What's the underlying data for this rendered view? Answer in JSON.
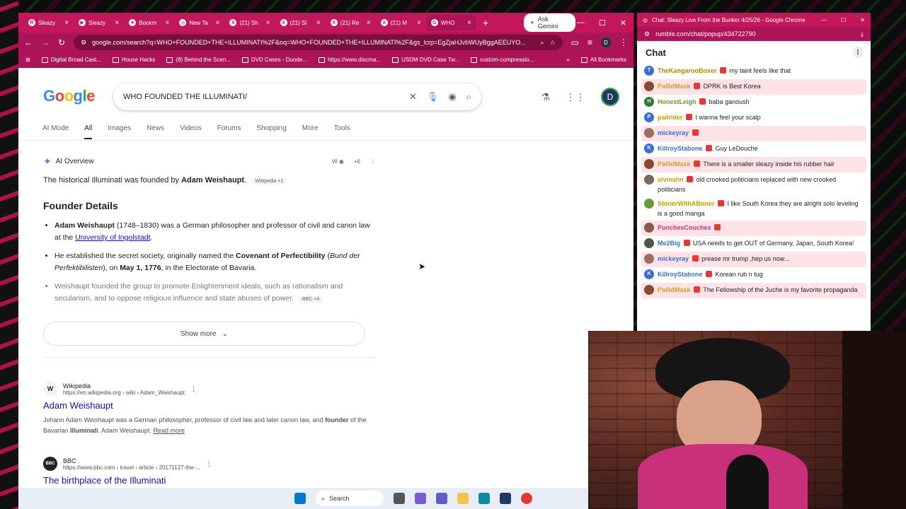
{
  "browser": {
    "tabs": [
      {
        "label": "Sleazy",
        "icon": "R",
        "active": false
      },
      {
        "label": "Sleazy",
        "icon": "▶",
        "active": false
      },
      {
        "label": "Bookm",
        "icon": "★",
        "active": false
      },
      {
        "label": "New Ta",
        "icon": "◎",
        "active": false
      },
      {
        "label": "(21) Sh",
        "icon": "X",
        "active": false
      },
      {
        "label": "(21) Sl",
        "icon": "X",
        "active": false
      },
      {
        "label": "(21) Re",
        "icon": "X",
        "active": false
      },
      {
        "label": "(21) M",
        "icon": "X",
        "active": false
      },
      {
        "label": "WHO",
        "icon": "G",
        "active": true
      }
    ],
    "ask_gemini": "Ask Gemini",
    "url": "google.com/search?q=WHO+FOUNDED+THE+ILLUMINATI%2F&oq=WHO+FOUNDED+THE+ILLUMINATI%2F&gs_lcrp=EgZjaHJvbWUyBggAEEUYO...",
    "profile_initial": "D",
    "bookmarks": [
      "Digital Broad Cast...",
      "House Hacks",
      "(8) Behind the Scen...",
      "DVD Cases - Duode...",
      "https://www.discma...",
      "USDM DVD Case Tw...",
      "custom-compressio..."
    ],
    "all_bookmarks": "All Bookmarks",
    "accent": "#c2185b"
  },
  "google": {
    "logo": "Google",
    "query": "WHO FOUNDED THE ILLUMINATI/",
    "account_initial": "D",
    "nav": [
      "AI Mode",
      "All",
      "Images",
      "News",
      "Videos",
      "Forums",
      "Shopping",
      "More",
      "Tools"
    ],
    "ai_overview": {
      "label": "AI Overview",
      "sources_more": "+6",
      "lead_pre": "The historical Illuminati was founded by ",
      "lead_bold": "Adam Weishaupt",
      "lead_post": ".",
      "lead_chip": "Wikipedia +1",
      "heading": "Founder Details",
      "b1_bold": "Adam Weishaupt",
      "b1_text": " (1748–1830) was a German philosopher and professor of civil and canon law at the ",
      "b1_link": "University of Ingolstadt",
      "b1_end": ".",
      "b2_pre": "He established the secret society, originally named the ",
      "b2_bold": "Covenant of Perfectibility",
      "b2_mid": " (",
      "b2_italic": "Bund der Perfektibilisten",
      "b2_mid2": "), on ",
      "b2_date": "May 1, 1776",
      "b2_end": ", in the Electorate of Bavaria.",
      "b3": "Weishaupt founded the group to promote Enlightenment ideals, such as rationalism and secularism, and to oppose religious influence and state abuses of power.",
      "b3_chip": "BBC +4",
      "show_more": "Show more"
    },
    "results": [
      {
        "site": "Wikipedia",
        "fav": "W",
        "cite": "https://en.wikipedia.org › wiki › Adam_Weishaupt",
        "title": "Adam Weishaupt",
        "snippet_pre": "Johann Adam Weishaupt was a German philosopher, professor of civil law and later canon law, and ",
        "snippet_b1": "founder",
        "snippet_mid": " of the Bavarian ",
        "snippet_b2": "Illuminati",
        "snippet_post": ". Adam Weishaupt.",
        "read_more": "Read more"
      },
      {
        "site": "BBC",
        "fav": "BBC",
        "cite": "https://www.bbc.com › travel › article › 20171127-the-...",
        "title": "The birthplace of the Illuminati"
      }
    ]
  },
  "chat": {
    "window_title": "Chat: Sleazy Live From the Bunker 4/25/26 - Google Chrome",
    "url": "rumble.com/chat/popup/434722790",
    "heading": "Chat",
    "messages": [
      {
        "user": "TheKangarooBoxer",
        "text": "my taint feels like that",
        "color": "#b58900",
        "ava": "#3b6fd4",
        "hl": false,
        "ava_letter": "T"
      },
      {
        "user": "PallidMask",
        "text": "DPRK is Best Korea",
        "color": "#d4a017",
        "ava": "#8a4a30",
        "hl": true,
        "ava_letter": ""
      },
      {
        "user": "HonestLeigh",
        "text": "baba ganoush",
        "color": "#6a9a2a",
        "ava": "#2e7d32",
        "hl": false,
        "ava_letter": "H"
      },
      {
        "user": "pailrider",
        "text": "I wanna feel your scalp",
        "color": "#c2a000",
        "ava": "#3b6fd4",
        "hl": false,
        "ava_letter": "P"
      },
      {
        "user": "mickeyray",
        "text": "",
        "color": "#3b6fd4",
        "ava": "#9a7060",
        "hl": true,
        "ava_letter": ""
      },
      {
        "user": "KillroyStabone",
        "text": "Guy LeDouche",
        "color": "#3b6fd4",
        "ava": "#3b6fd4",
        "hl": false,
        "ava_letter": "K"
      },
      {
        "user": "PallidMask",
        "text": "There is a smaller sleazy inside his rubber hair",
        "color": "#d4a017",
        "ava": "#8a4a30",
        "hl": true,
        "ava_letter": ""
      },
      {
        "user": "alvmahn",
        "text": "old crooked politicians replaced with new crooked politicians",
        "color": "#d4a017",
        "ava": "#7a6a5a",
        "hl": false,
        "ava_letter": ""
      },
      {
        "user": "StonerWithABoner",
        "text": "I like South Korea they are alright solo leveling is a good manga",
        "color": "#c2a000",
        "ava": "#6a9a3a",
        "hl": false,
        "ava_letter": ""
      },
      {
        "user": "PunchesCouches",
        "text": "",
        "color": "#d4307a",
        "ava": "#8a5a4a",
        "hl": true,
        "ava_letter": ""
      },
      {
        "user": "Me2Big",
        "text": "USA needs to get OUT of Germany, Japan, South Korea!",
        "color": "#3b6fd4",
        "ava": "#4a5a4a",
        "hl": false,
        "ava_letter": ""
      },
      {
        "user": "mickeyray",
        "text": "prease mr trump ,hep us now...",
        "color": "#3b6fd4",
        "ava": "#9a7060",
        "hl": true,
        "ava_letter": ""
      },
      {
        "user": "KillroyStabone",
        "text": "Korean rub n tug",
        "color": "#3b6fd4",
        "ava": "#3b6fd4",
        "hl": false,
        "ava_letter": "K"
      },
      {
        "user": "PallidMask",
        "text": "The Fellowship of the Juche is my favorite propaganda",
        "color": "#d4a017",
        "ava": "#8a4a30",
        "hl": true,
        "ava_letter": ""
      }
    ]
  },
  "taskbar": {
    "search_label": "Search"
  }
}
